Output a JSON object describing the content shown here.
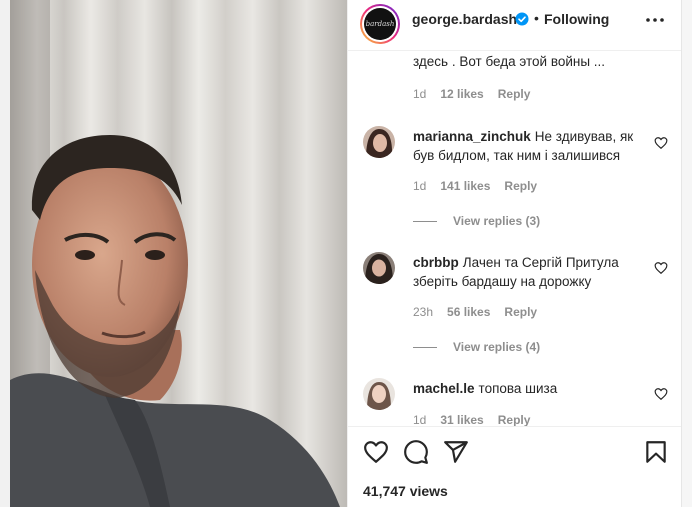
{
  "post": {
    "username": "george.bardash",
    "following_label": "Following",
    "dot": "•",
    "avatar_text": "bardash"
  },
  "comments": [
    {
      "text": "здесь . Вот беда этой войны ...",
      "time": "1d",
      "likes": "12 likes",
      "reply": "Reply"
    },
    {
      "user": "marianna_zinchuk",
      "text": "Не здивував, як був бидлом, так ним і залишився",
      "time": "1d",
      "likes": "141 likes",
      "reply": "Reply",
      "view_replies": "View replies (3)"
    },
    {
      "user": "cbrbbp",
      "text": "Лачен та Сергій Притула зберіть бардашу на дорожку",
      "time": "23h",
      "likes": "56 likes",
      "reply": "Reply",
      "view_replies": "View replies (4)"
    },
    {
      "user": "machel.le",
      "text": "топова шиза",
      "time": "1d",
      "likes": "31 likes",
      "reply": "Reply"
    }
  ],
  "footer": {
    "views": "41,747 views"
  },
  "icons": {
    "like": "heart-icon",
    "comment": "comment-icon",
    "share": "share-icon",
    "save": "bookmark-icon",
    "more": "more-icon",
    "verified": "verified-badge-icon"
  },
  "colors": {
    "verified": "#0095f6",
    "meta": "#8e8e8e",
    "text": "#262626"
  }
}
